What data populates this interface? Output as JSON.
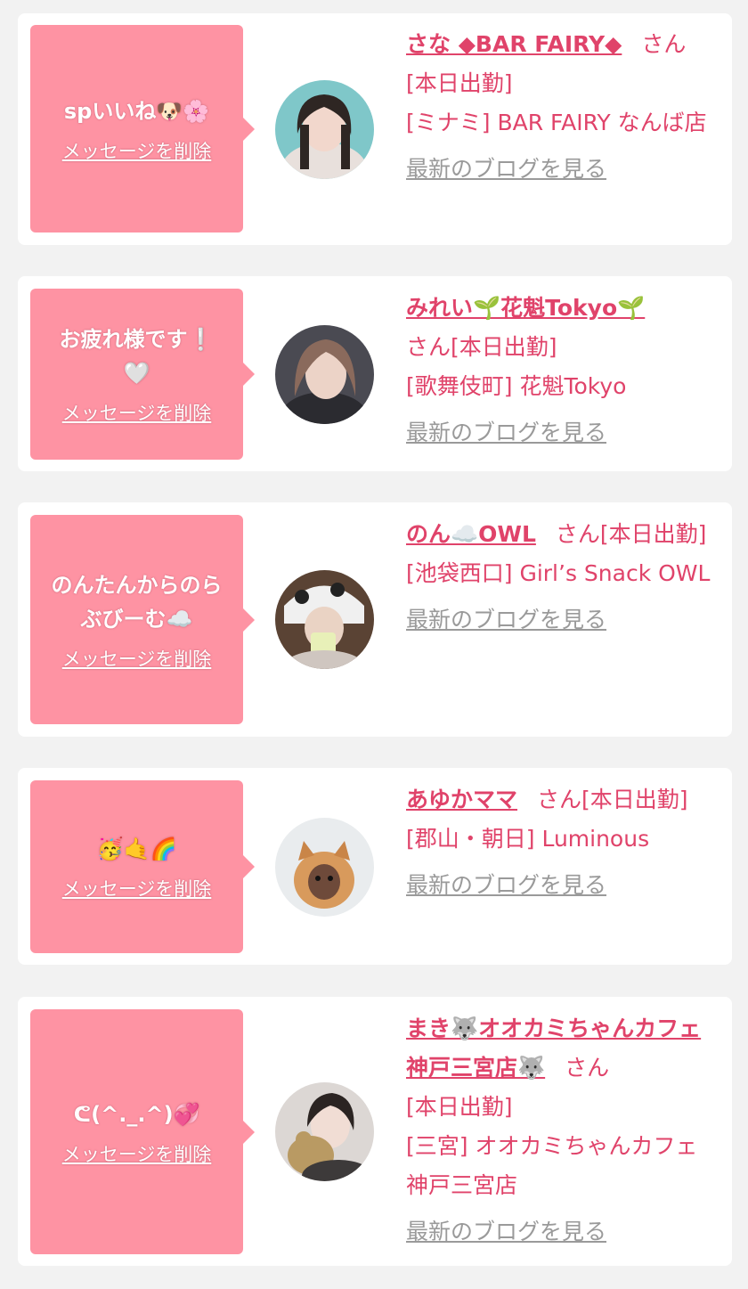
{
  "colors": {
    "page_bg": "#f2f2f2",
    "card_bg": "#ffffff",
    "bubble_bg": "#fe93a3",
    "accent_text": "#e0436a",
    "link_gray": "#9a9a9a"
  },
  "cards": [
    {
      "message": "spいいね🐶🌸",
      "delete_label": "メッセージを削除",
      "avatar": "avatar-photo-1",
      "name": "さな ◆BAR FAIRY◆",
      "honorific": "さん",
      "status": "[本日出勤]",
      "shop": "[ミナミ] BAR FAIRY なんば店",
      "blog_link": "最新のブログを見る"
    },
    {
      "message": "お疲れ様です❕🤍",
      "delete_label": "メッセージを削除",
      "avatar": "avatar-photo-2",
      "name": "みれい🌱花魁Tokyo🌱",
      "honorific": "さん",
      "status": "[本日出勤]",
      "shop": "[歌舞伎町] 花魁Tokyo",
      "blog_link": "最新のブログを見る"
    },
    {
      "message": "のんたんからのらぶびーむ☁️",
      "delete_label": "メッセージを削除",
      "avatar": "avatar-photo-3",
      "name": "のん☁️OWL",
      "honorific": "さん",
      "status": "[本日出勤]",
      "shop": "[池袋西口] Girl’s Snack OWL",
      "blog_link": "最新のブログを見る"
    },
    {
      "message": "🥳🤙🌈",
      "delete_label": "メッセージを削除",
      "avatar": "avatar-photo-4",
      "name": "あゆかママ",
      "honorific": "さん",
      "status": "[本日出勤]",
      "shop": "[郡山・朝日] Luminous",
      "blog_link": "最新のブログを見る"
    },
    {
      "message": "ᕦ(^._.^)💞",
      "delete_label": "メッセージを削除",
      "avatar": "avatar-photo-5",
      "name": "まき🐺オオカミちゃんカフェ神戸三宮店🐺",
      "honorific": "さん",
      "status": "[本日出勤]",
      "shop": "[三宮] オオカミちゃんカフェ神戸三宮店",
      "blog_link": "最新のブログを見る"
    }
  ]
}
